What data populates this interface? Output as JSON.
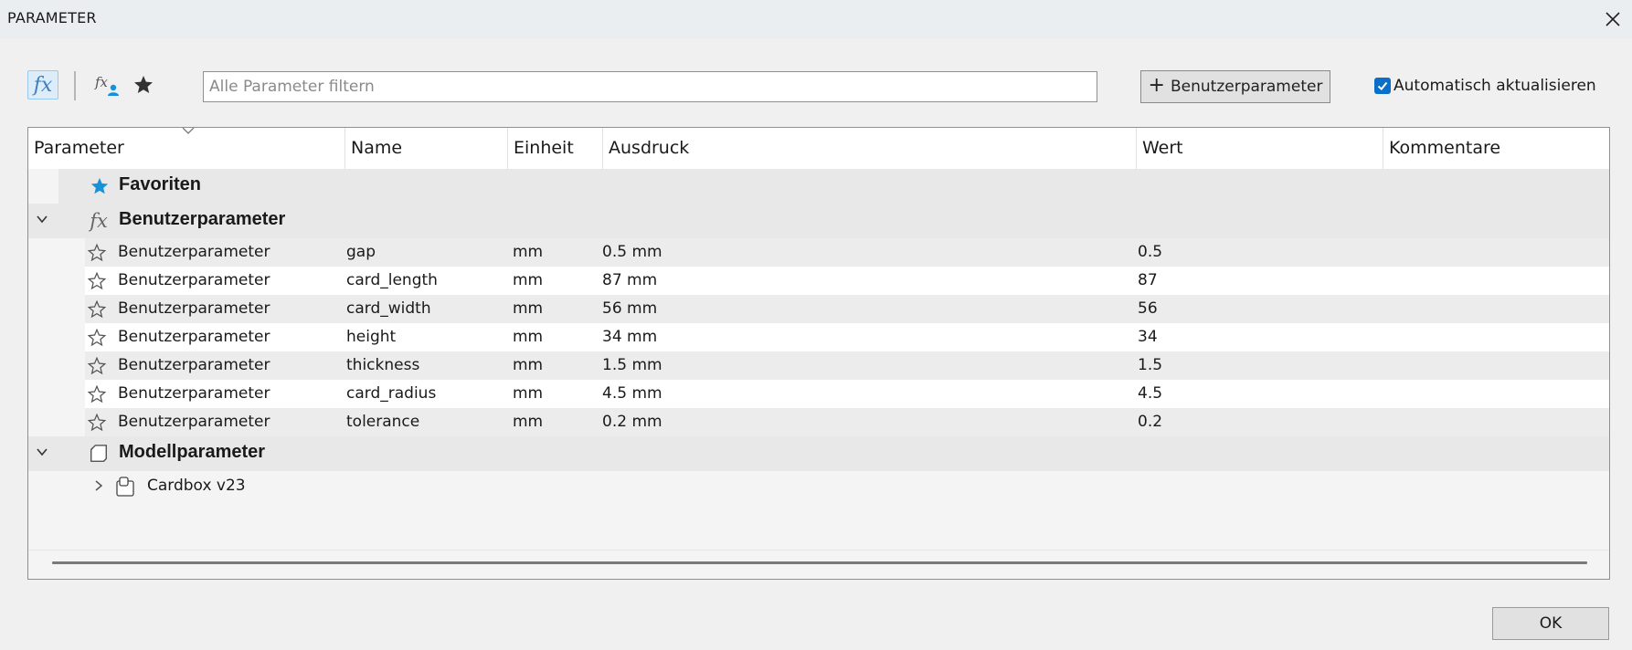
{
  "window": {
    "title": "PARAMETER",
    "close_icon": "close-icon"
  },
  "toolbar": {
    "fx_icon": "fx-icon",
    "fx_glyph": "fx",
    "fx_user_icon": "fx-user-icon",
    "star_icon": "star-icon",
    "filter_placeholder": "Alle Parameter filtern",
    "filter_value": "",
    "add_user_param_label": "Benutzerparameter",
    "auto_update_label": "Automatisch aktualisieren",
    "auto_update_checked": true
  },
  "table": {
    "columns": [
      "Parameter",
      "Name",
      "Einheit",
      "Ausdruck",
      "Wert",
      "Kommentare"
    ],
    "groups": {
      "favorites": "Favoriten",
      "user_params": "Benutzerparameter",
      "model_params": "Modellparameter"
    },
    "rows": [
      {
        "param": "Benutzerparameter",
        "name": "gap",
        "unit": "mm",
        "expr": "0.5 mm",
        "value": "0.5",
        "comment": ""
      },
      {
        "param": "Benutzerparameter",
        "name": "card_length",
        "unit": "mm",
        "expr": "87 mm",
        "value": "87",
        "comment": ""
      },
      {
        "param": "Benutzerparameter",
        "name": "card_width",
        "unit": "mm",
        "expr": "56 mm",
        "value": "56",
        "comment": ""
      },
      {
        "param": "Benutzerparameter",
        "name": "height",
        "unit": "mm",
        "expr": "34 mm",
        "value": "34",
        "comment": ""
      },
      {
        "param": "Benutzerparameter",
        "name": "thickness",
        "unit": "mm",
        "expr": "1.5 mm",
        "value": "1.5",
        "comment": ""
      },
      {
        "param": "Benutzerparameter",
        "name": "card_radius",
        "unit": "mm",
        "expr": "4.5 mm",
        "value": "4.5",
        "comment": ""
      },
      {
        "param": "Benutzerparameter",
        "name": "tolerance",
        "unit": "mm",
        "expr": "0.2 mm",
        "value": "0.2",
        "comment": ""
      }
    ],
    "component": "Cardbox v23"
  },
  "footer": {
    "ok_label": "OK"
  },
  "colors": {
    "accent": "#0b6fc7",
    "fav_star": "#1592d9",
    "title_bar": "#eaeef1"
  }
}
